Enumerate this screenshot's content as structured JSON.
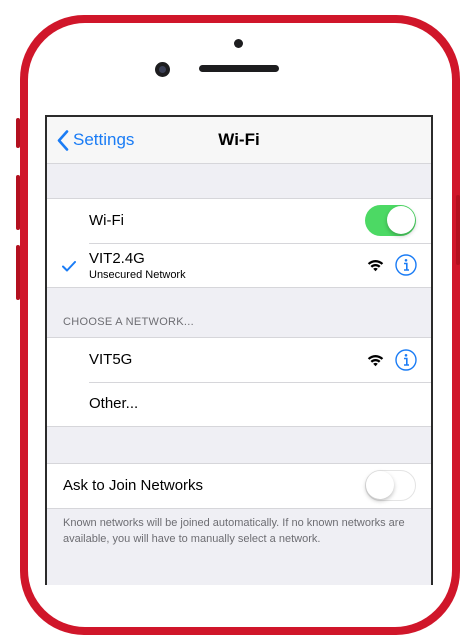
{
  "nav": {
    "back_label": "Settings",
    "title": "Wi-Fi"
  },
  "wifi_toggle": {
    "label": "Wi-Fi",
    "state": "on"
  },
  "current_network": {
    "name": "VIT2.4G",
    "status": "Unsecured Network",
    "connected": true
  },
  "choose_header": "CHOOSE A NETWORK...",
  "networks": [
    {
      "name": "VIT5G"
    }
  ],
  "other_label": "Other...",
  "ask_to_join": {
    "label": "Ask to Join Networks",
    "state": "off",
    "footer": "Known networks will be joined automatically. If no known networks are available, you will have to manually select a network."
  },
  "colors": {
    "accent": "#1a7cf5",
    "toggle_on": "#4cd964",
    "phone_body": "#d0162a"
  },
  "icons": [
    "chevron-left-icon",
    "checkmark-icon",
    "wifi-signal-icon",
    "info-icon"
  ]
}
